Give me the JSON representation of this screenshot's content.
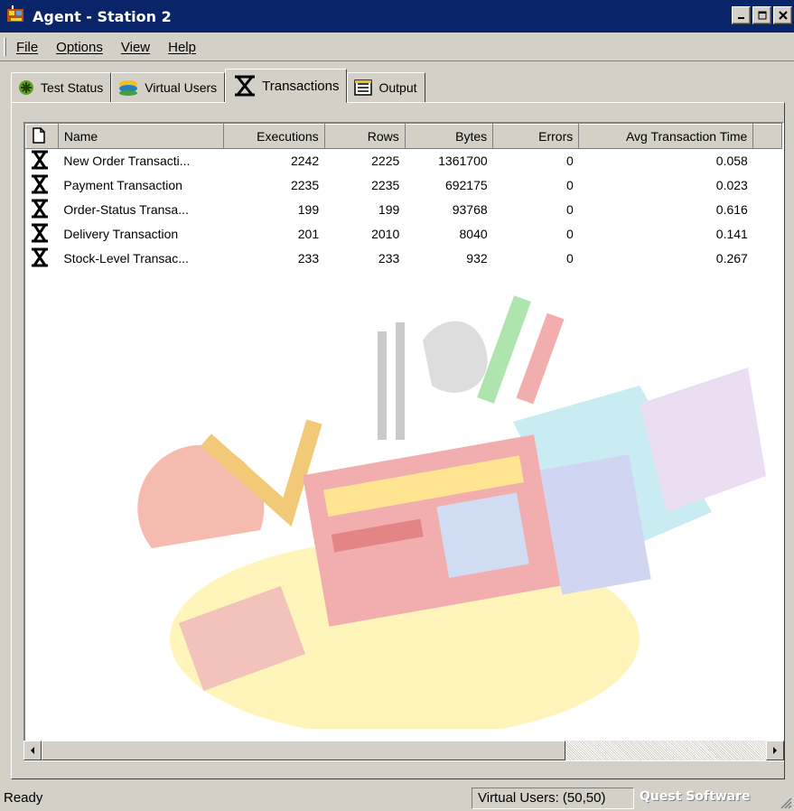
{
  "window": {
    "title": "Agent - Station 2"
  },
  "menu": {
    "items": [
      "File",
      "Options",
      "View",
      "Help"
    ]
  },
  "tabs": [
    {
      "label": "Test Status",
      "icon": "test-status-icon",
      "active": false
    },
    {
      "label": "Virtual Users",
      "icon": "virtual-users-icon",
      "active": false
    },
    {
      "label": "Transactions",
      "icon": "transaction-icon",
      "active": true
    },
    {
      "label": "Output",
      "icon": "output-icon",
      "active": false
    }
  ],
  "table": {
    "columns": [
      "Name",
      "Executions",
      "Rows",
      "Bytes",
      "Errors",
      "Avg Transaction Time"
    ],
    "rows": [
      {
        "name": "New Order Transacti...",
        "executions": "2242",
        "rows": "2225",
        "bytes": "1361700",
        "errors": "0",
        "avg_time": "0.058"
      },
      {
        "name": "Payment Transaction",
        "executions": "2235",
        "rows": "2235",
        "bytes": "692175",
        "errors": "0",
        "avg_time": "0.023"
      },
      {
        "name": "Order-Status Transa...",
        "executions": "199",
        "rows": "199",
        "bytes": "93768",
        "errors": "0",
        "avg_time": "0.616"
      },
      {
        "name": "Delivery Transaction",
        "executions": "201",
        "rows": "2010",
        "bytes": "8040",
        "errors": "0",
        "avg_time": "0.141"
      },
      {
        "name": "Stock-Level Transac...",
        "executions": "233",
        "rows": "233",
        "bytes": "932",
        "errors": "0",
        "avg_time": "0.267"
      }
    ]
  },
  "status": {
    "ready": "Ready",
    "virtual_users": "Virtual Users: (50,50)",
    "brand": "Quest Software"
  },
  "colors": {
    "titlebar": "#0a246a",
    "face": "#d4d0c8"
  }
}
